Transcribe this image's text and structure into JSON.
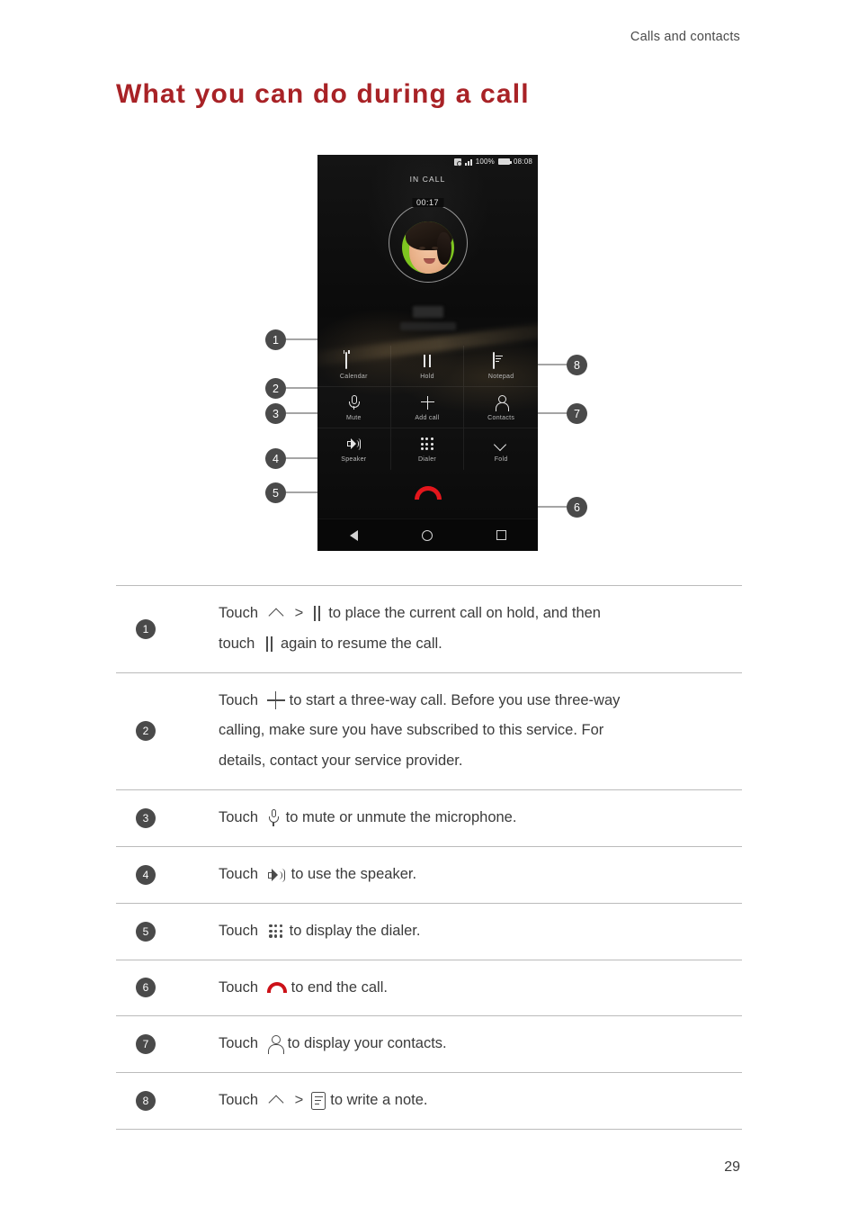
{
  "header": {
    "running_head": "Calls and contacts",
    "title": "What you can do during a call",
    "title_color": "#A82226"
  },
  "figure": {
    "phone": {
      "statusbar": {
        "alarm_icon": "alarm-icon",
        "signal_icon": "signal-bars-icon",
        "battery_percent": "100%",
        "battery_icon": "battery-icon",
        "clock": "08:08"
      },
      "call_state": "IN CALL",
      "call_timer": "00:17",
      "avatar": "contact-photo",
      "buttons": [
        {
          "icon": "calendar-icon",
          "label": "Calendar"
        },
        {
          "icon": "pause-icon",
          "label": "Hold"
        },
        {
          "icon": "notepad-icon",
          "label": "Notepad"
        },
        {
          "icon": "microphone-icon",
          "label": "Mute"
        },
        {
          "icon": "plus-icon",
          "label": "Add call"
        },
        {
          "icon": "person-icon",
          "label": "Contacts"
        },
        {
          "icon": "speaker-icon",
          "label": "Speaker"
        },
        {
          "icon": "dialpad-icon",
          "label": "Dialer"
        },
        {
          "icon": "chevron-down-icon",
          "label": "Fold"
        }
      ],
      "end_call_icon": "end-call-icon",
      "navbar": [
        "back-icon",
        "home-icon",
        "recents-icon"
      ]
    },
    "callouts": [
      {
        "number": "1",
        "side": "left"
      },
      {
        "number": "2",
        "side": "left"
      },
      {
        "number": "3",
        "side": "left"
      },
      {
        "number": "4",
        "side": "left"
      },
      {
        "number": "5",
        "side": "left"
      },
      {
        "number": "6",
        "side": "right"
      },
      {
        "number": "7",
        "side": "right"
      },
      {
        "number": "8",
        "side": "right"
      }
    ]
  },
  "table": {
    "rows": [
      {
        "number": "1",
        "lines": [
          {
            "parts": [
              {
                "t": "text",
                "v": "Touch"
              },
              {
                "t": "icon",
                "v": "caret-up-icon"
              },
              {
                "t": "text",
                "v": ">"
              },
              {
                "t": "icon",
                "v": "pause-icon"
              },
              {
                "t": "text",
                "v": "to place the current call on hold, and then"
              }
            ]
          },
          {
            "parts": [
              {
                "t": "text",
                "v": "touch"
              },
              {
                "t": "icon",
                "v": "pause-icon"
              },
              {
                "t": "text",
                "v": "again to resume the call."
              }
            ]
          }
        ]
      },
      {
        "number": "2",
        "lines": [
          {
            "parts": [
              {
                "t": "text",
                "v": "Touch"
              },
              {
                "t": "icon",
                "v": "plus-icon"
              },
              {
                "t": "text",
                "v": "to start a three-way call. Before you use three-way"
              }
            ]
          },
          {
            "parts": [
              {
                "t": "text",
                "v": "calling, make sure you have subscribed to this service. For"
              }
            ]
          },
          {
            "parts": [
              {
                "t": "text",
                "v": "details, contact your service provider."
              }
            ]
          }
        ]
      },
      {
        "number": "3",
        "lines": [
          {
            "parts": [
              {
                "t": "text",
                "v": "Touch"
              },
              {
                "t": "icon",
                "v": "microphone-icon"
              },
              {
                "t": "text",
                "v": "to mute or unmute the microphone."
              }
            ]
          }
        ]
      },
      {
        "number": "4",
        "lines": [
          {
            "parts": [
              {
                "t": "text",
                "v": "Touch"
              },
              {
                "t": "icon",
                "v": "speaker-icon"
              },
              {
                "t": "text",
                "v": "to use the speaker."
              }
            ]
          }
        ]
      },
      {
        "number": "5",
        "lines": [
          {
            "parts": [
              {
                "t": "text",
                "v": "Touch"
              },
              {
                "t": "icon",
                "v": "dialpad-icon"
              },
              {
                "t": "text",
                "v": "to display the dialer."
              }
            ]
          }
        ]
      },
      {
        "number": "6",
        "lines": [
          {
            "parts": [
              {
                "t": "text",
                "v": "Touch"
              },
              {
                "t": "icon",
                "v": "end-call-icon"
              },
              {
                "t": "text",
                "v": "to end the call."
              }
            ]
          }
        ]
      },
      {
        "number": "7",
        "lines": [
          {
            "parts": [
              {
                "t": "text",
                "v": "Touch"
              },
              {
                "t": "icon",
                "v": "person-icon"
              },
              {
                "t": "text",
                "v": "to display your contacts."
              }
            ]
          }
        ]
      },
      {
        "number": "8",
        "lines": [
          {
            "parts": [
              {
                "t": "text",
                "v": "Touch"
              },
              {
                "t": "icon",
                "v": "caret-up-icon"
              },
              {
                "t": "text",
                "v": ">"
              },
              {
                "t": "icon",
                "v": "notepad-icon"
              },
              {
                "t": "text",
                "v": "to write a note."
              }
            ]
          }
        ]
      }
    ]
  },
  "footer": {
    "page_number": "29"
  }
}
